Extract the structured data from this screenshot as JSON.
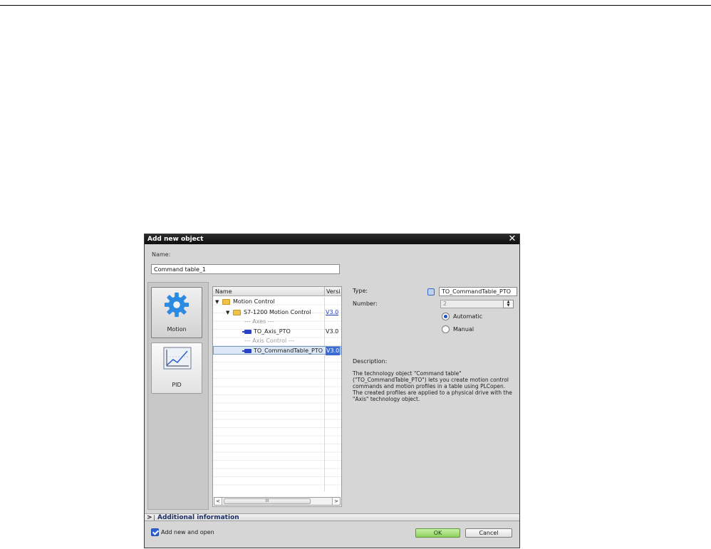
{
  "dialog": {
    "title": "Add new object",
    "close_glyph": "✕",
    "name_label": "Name:",
    "name_value": "Command table_1"
  },
  "categories": [
    {
      "label": "Motion",
      "icon": "gear-icon",
      "selected": true
    },
    {
      "label": "PID",
      "icon": "pid-chart-icon",
      "selected": false
    }
  ],
  "tree": {
    "columns": [
      "Name",
      "Versi"
    ],
    "rows": [
      {
        "label": "Motion Control",
        "version": "",
        "kind": "folder",
        "expanded": true
      },
      {
        "label": "S7-1200 Motion Control",
        "version": "V3.0",
        "kind": "folder",
        "expanded": true
      },
      {
        "label": "--- Axes ---",
        "version": "",
        "kind": "separator"
      },
      {
        "label": "TO_Axis_PTO",
        "version": "V3.0",
        "kind": "object"
      },
      {
        "label": "--- Axis Control ---",
        "version": "",
        "kind": "separator"
      },
      {
        "label": "TO_CommandTable_PTO",
        "version": "V3.0",
        "kind": "object",
        "selected": true
      }
    ],
    "scroll_left": "<",
    "scroll_right": ">",
    "scroll_grip": "III"
  },
  "details": {
    "type_label": "Type:",
    "type_value": "TO_CommandTable_PTO",
    "number_label": "Number:",
    "number_value": "2",
    "radio_automatic": "Automatic",
    "radio_manual": "Manual",
    "description_label": "Description:",
    "description_text": "The technology object \"Command table\" (\"TO_CommandTable_PTO\") lets you create motion control commands and motion profiles in a table using PLCopen. The created profiles are applied to a physical drive with the \"Axis\" technology object."
  },
  "additional_info": {
    "chevron": ">",
    "title": "Additional  information"
  },
  "footer": {
    "add_new_and_open": "Add new and open",
    "ok_label": "OK",
    "cancel_label": "Cancel"
  },
  "colors": {
    "accent": "#1d4fd2",
    "ok_button": "#8fd05d",
    "folder": "#f1c24a"
  }
}
